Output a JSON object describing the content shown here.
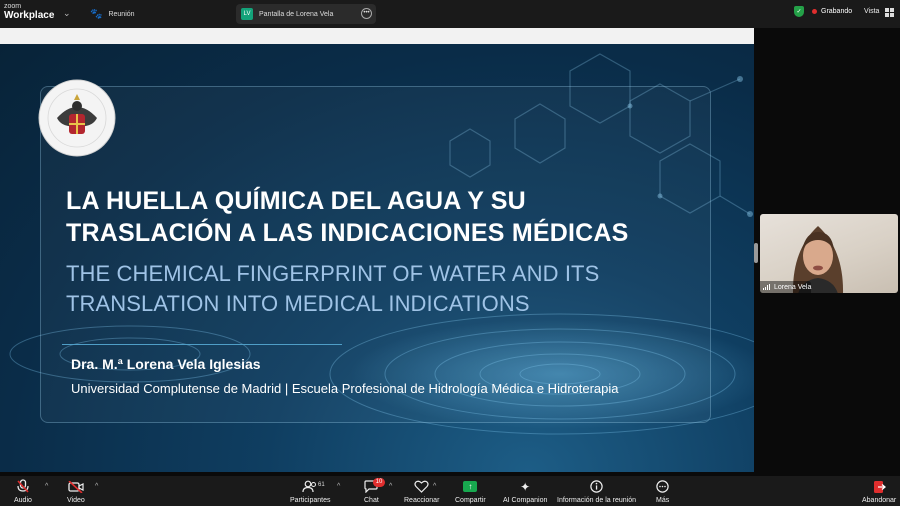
{
  "app": {
    "logo_line1": "zoom",
    "logo_line2": "Workplace"
  },
  "tabs": [
    {
      "label": "Reunión",
      "icon": "paw-icon"
    },
    {
      "label": "Pantalla de Lorena Vela",
      "badge": "LV"
    }
  ],
  "status": {
    "recording": "Grabando",
    "view": "Vista"
  },
  "slide": {
    "title_line1": "LA HUELLA QUÍMICA DEL AGUA Y SU",
    "title_line2": "TRASLACIÓN A LAS INDICACIONES MÉDICAS",
    "subtitle_line1": "THE CHEMICAL FINGERPRINT OF WATER AND ITS",
    "subtitle_line2": "TRANSLATION INTO MEDICAL INDICATIONS",
    "author": "Dra. M.ª Lorena Vela Iglesias",
    "affiliation": "Universidad Complutense de Madrid | Escuela Profesional de Hidrología Médica e Hidroterapia"
  },
  "participant": {
    "name": "Lorena Vela"
  },
  "toolbar": {
    "audio": "Audio",
    "video": "Video",
    "participants": "Participantes",
    "participants_count": "61",
    "chat": "Chat",
    "chat_badge": "10",
    "react": "Reaccionar",
    "share": "Compartir",
    "ai": "AI Companion",
    "info": "Información de la reunión",
    "more": "Más",
    "leave": "Abandonar"
  },
  "colors": {
    "share": "#18a84f",
    "recording": "#e02e2e",
    "shield": "#24a148",
    "slide_bg": "#0a2c48",
    "subtitle": "#9fc3e6"
  }
}
